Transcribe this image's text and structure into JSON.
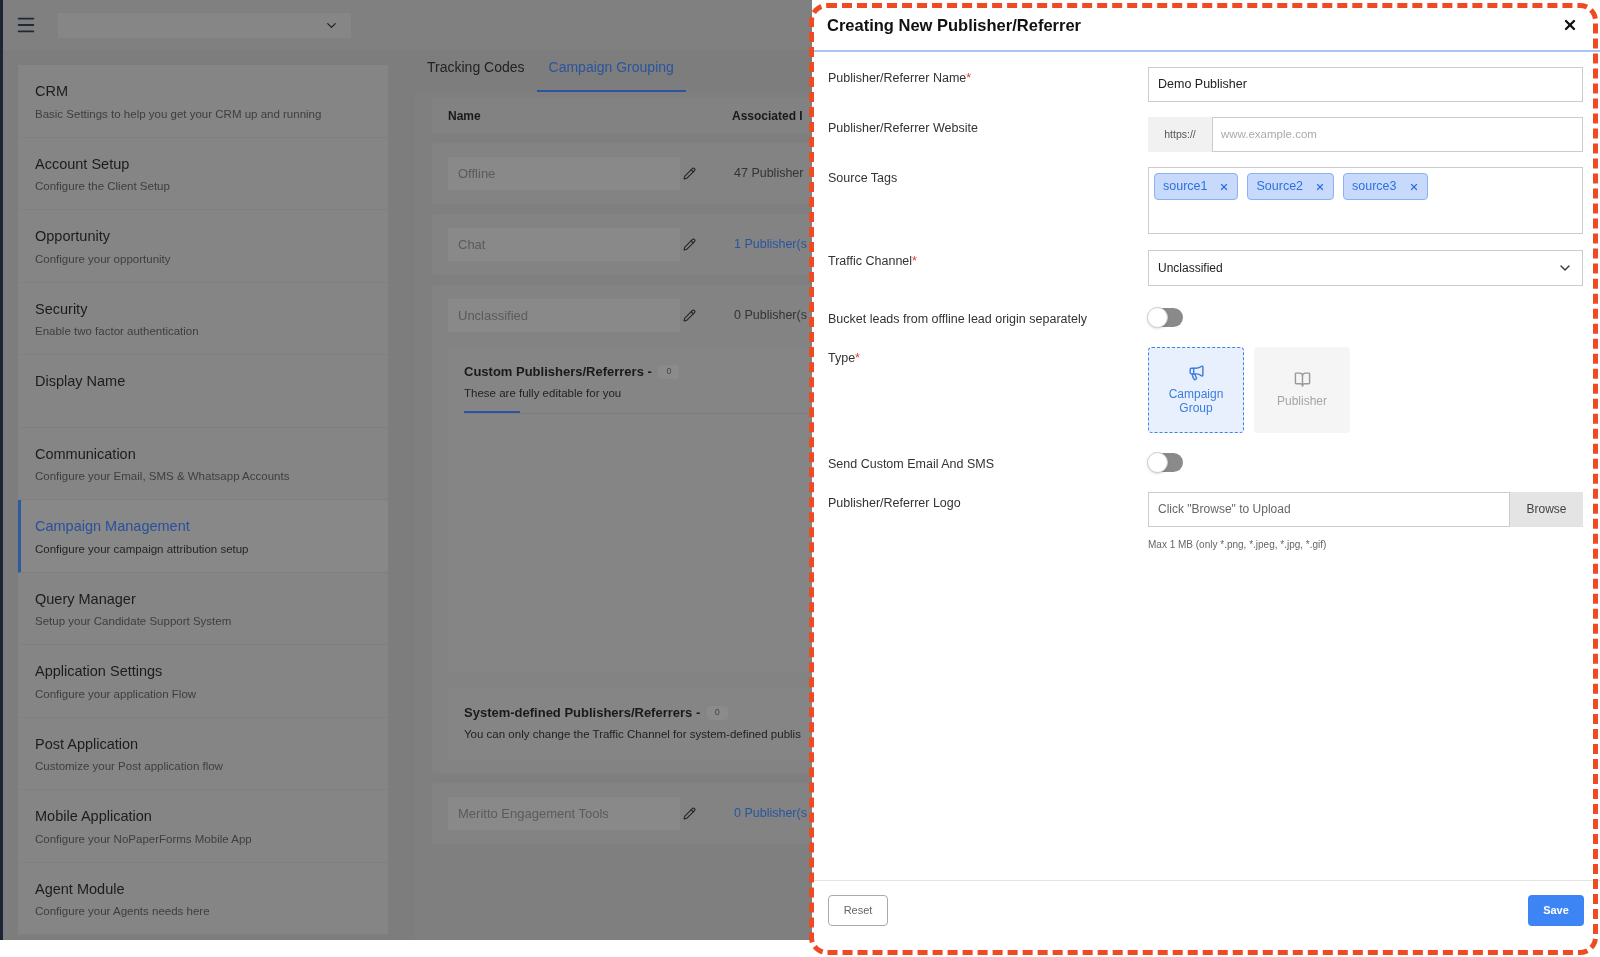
{
  "sidebar": {
    "items": [
      {
        "title": "CRM",
        "subtitle": "Basic Settings to help you get your CRM up and running",
        "selected": false
      },
      {
        "title": "Account Setup",
        "subtitle": "Configure the Client Setup",
        "selected": false
      },
      {
        "title": "Opportunity",
        "subtitle": "Configure your opportunity",
        "selected": false
      },
      {
        "title": "Security",
        "subtitle": "Enable two factor authentication",
        "selected": false
      },
      {
        "title": "Display Name",
        "selected": false
      },
      {
        "title": "Communication",
        "subtitle": "Configure your Email, SMS & Whatsapp Accounts",
        "selected": false
      },
      {
        "title": "Campaign Management",
        "subtitle": "Configure your campaign attribution setup",
        "selected": true
      },
      {
        "title": "Query Manager",
        "subtitle": "Setup your Candidate Support System",
        "selected": false
      },
      {
        "title": "Application Settings",
        "subtitle": "Configure your application Flow",
        "selected": false
      },
      {
        "title": "Post Application",
        "subtitle": "Customize your Post application flow",
        "selected": false
      },
      {
        "title": "Mobile Application",
        "subtitle": "Configure your NoPaperForms Mobile App",
        "selected": false
      },
      {
        "title": "Agent Module",
        "subtitle": "Configure your Agents needs here",
        "selected": false
      }
    ]
  },
  "tabs": [
    {
      "label": "Tracking Codes",
      "selected": false
    },
    {
      "label": "Campaign Grouping",
      "selected": true
    }
  ],
  "table": {
    "columns": [
      "Name",
      "Associated I"
    ],
    "rows": [
      {
        "name": "Offline",
        "publishers": "47 Publisher",
        "linked": false
      },
      {
        "name": "Chat",
        "publishers": "1 Publisher(s",
        "linked": true
      },
      {
        "name": "Unclassified",
        "publishers": "0 Publisher(s",
        "linked": false,
        "sections": [
          {
            "title": "Custom Publishers/Referrers - ",
            "count": "0",
            "subtitle": "These are fully editable for you",
            "kind": "tabbed"
          },
          {
            "title": "System-defined Publishers/Referrers - ",
            "count": "0",
            "subtitle": "You can only change the Traffic Channel for system-defined publis",
            "kind": "plain"
          }
        ]
      },
      {
        "name": "Meritto Engagement Tools",
        "publishers": "0 Publisher(s",
        "linked": true
      }
    ]
  },
  "drawer": {
    "title": "Creating New Publisher/Referrer",
    "fields": [
      {
        "kind": "text",
        "label": "Publisher/Referrer Name",
        "required_mark": "*",
        "value": "Demo Publisher"
      },
      {
        "kind": "url",
        "label": "Publisher/Referrer Website",
        "prefix": "https://",
        "placeholder": "www.example.com"
      },
      {
        "kind": "tags",
        "label": "Source Tags",
        "tags": [
          "source1",
          "Source2",
          "source3"
        ]
      },
      {
        "kind": "select",
        "label": "Traffic Channel",
        "required_mark": "*",
        "value": "Unclassified"
      },
      {
        "kind": "toggle",
        "label": "Bucket leads from offline lead origin separately",
        "on": false
      },
      {
        "kind": "type",
        "label": "Type",
        "required_mark": "*",
        "options": [
          {
            "label": "Campaign Group",
            "kind": "megaphone",
            "selected": true
          },
          {
            "label": "Publisher",
            "kind": "book",
            "selected": false
          }
        ]
      },
      {
        "kind": "toggle",
        "label": "Send Custom Email And SMS",
        "on": false
      },
      {
        "kind": "file",
        "label": "Publisher/Referrer Logo",
        "placeholder": "Click \"Browse\" to Upload",
        "button": "Browse",
        "hint": "Max 1 MB (only *.png, *.jpeg, *.jpg, *.gif)"
      }
    ],
    "reset": "Reset",
    "save": "Save"
  }
}
